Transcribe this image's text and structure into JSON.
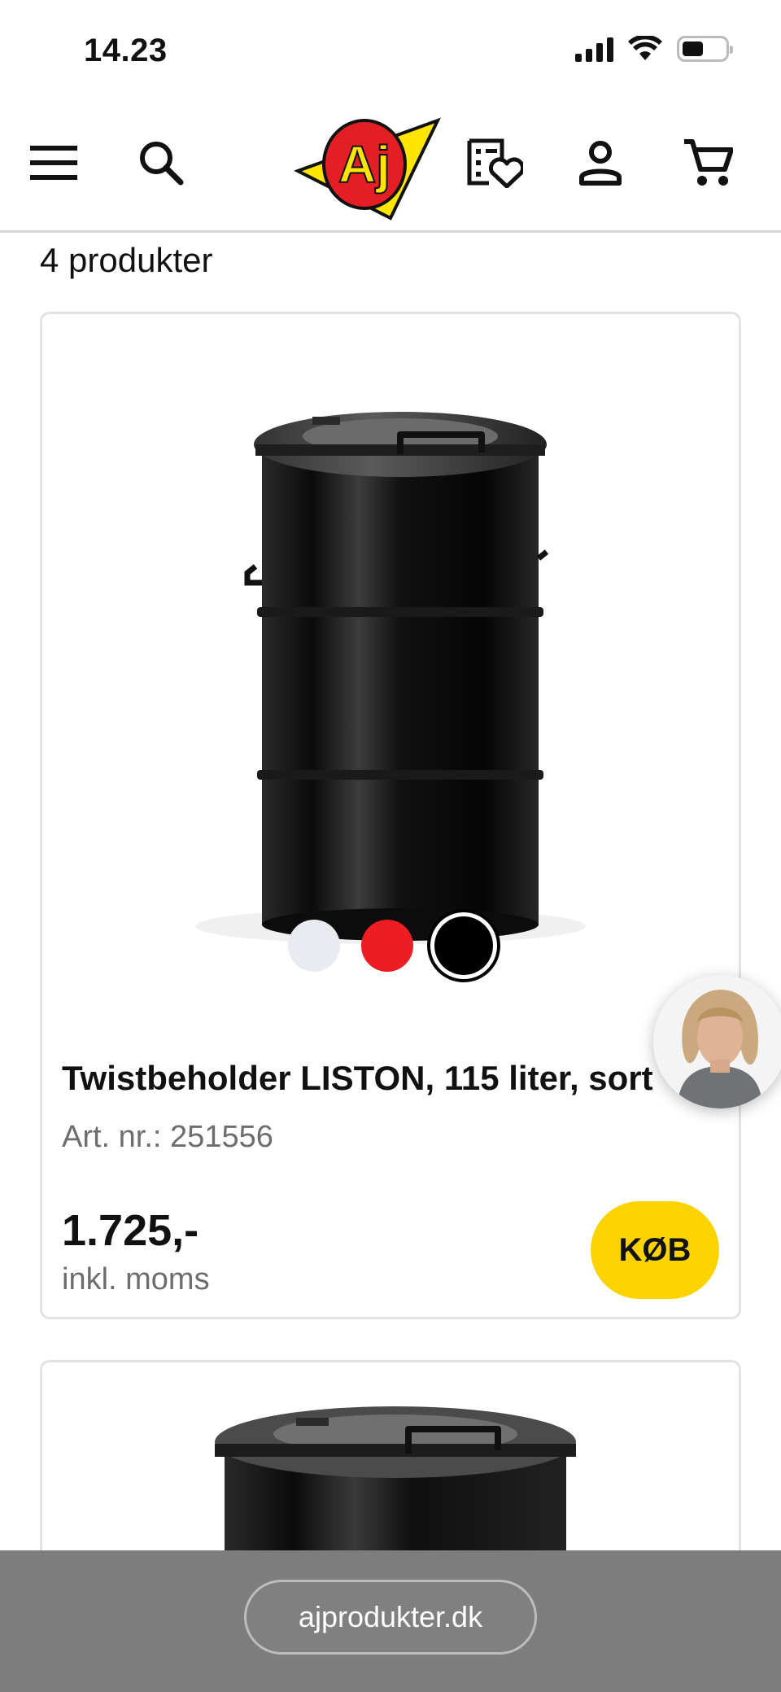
{
  "status_bar": {
    "time": "14.23"
  },
  "header": {
    "menu_icon": "hamburger-menu-icon",
    "search_icon": "search-icon",
    "logo_text": "Aj",
    "wishlist_icon": "wishlist-heart-icon",
    "account_icon": "user-icon",
    "cart_icon": "cart-icon"
  },
  "listing": {
    "count_label": "4 produkter"
  },
  "products": [
    {
      "title": "Twistbeholder LISTON, 115 liter, sort",
      "art_nr": "Art. nr.: 251556",
      "price": "1.725,-",
      "vat_note": "inkl. moms",
      "buy_label": "KØB",
      "swatches": [
        {
          "color": "#e8ecf0"
        },
        {
          "color": "#ee1d23"
        },
        {
          "color": "#000000",
          "selected": true
        }
      ]
    }
  ],
  "colors": {
    "accent": "#fbd400",
    "logo_red": "#e31e24",
    "logo_yellow": "#ffe500"
  },
  "browser": {
    "url": "ajprodukter.dk"
  }
}
